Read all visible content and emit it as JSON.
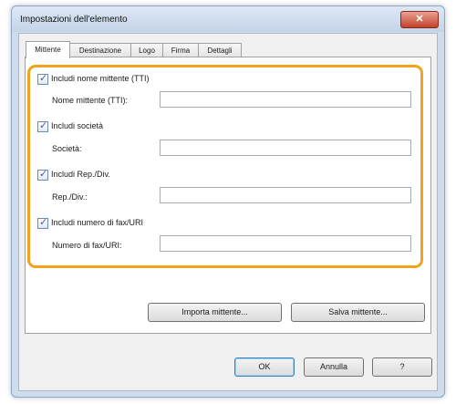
{
  "window": {
    "title": "Impostazioni dell'elemento",
    "close_glyph": "✕"
  },
  "tabs": [
    {
      "label": "Mittente"
    },
    {
      "label": "Destinazione"
    },
    {
      "label": "Logo"
    },
    {
      "label": "Firma"
    },
    {
      "label": "Dettagli"
    }
  ],
  "sender": {
    "include_name": {
      "label": "Includi nome mittente (TTI)",
      "checked": true
    },
    "name_field": {
      "label": "Nome mittente (TTI):",
      "value": ""
    },
    "include_company": {
      "label": "Includi società",
      "checked": true
    },
    "company_field": {
      "label": "Società:",
      "value": ""
    },
    "include_dept": {
      "label": "Includi Rep./Div.",
      "checked": true
    },
    "dept_field": {
      "label": "Rep./Div.:",
      "value": ""
    },
    "include_fax": {
      "label": "Includi numero di fax/URI",
      "checked": true
    },
    "fax_field": {
      "label": "Numero di fax/URI:",
      "value": ""
    },
    "check_glyph": "✓"
  },
  "buttons": {
    "import_sender": "Importa mittente...",
    "save_sender": "Salva mittente...",
    "ok": "OK",
    "cancel": "Annulla",
    "help": "?"
  },
  "colors": {
    "highlight": "#f2a31b",
    "titlebar": "#cfdcec",
    "close": "#c5422c"
  }
}
